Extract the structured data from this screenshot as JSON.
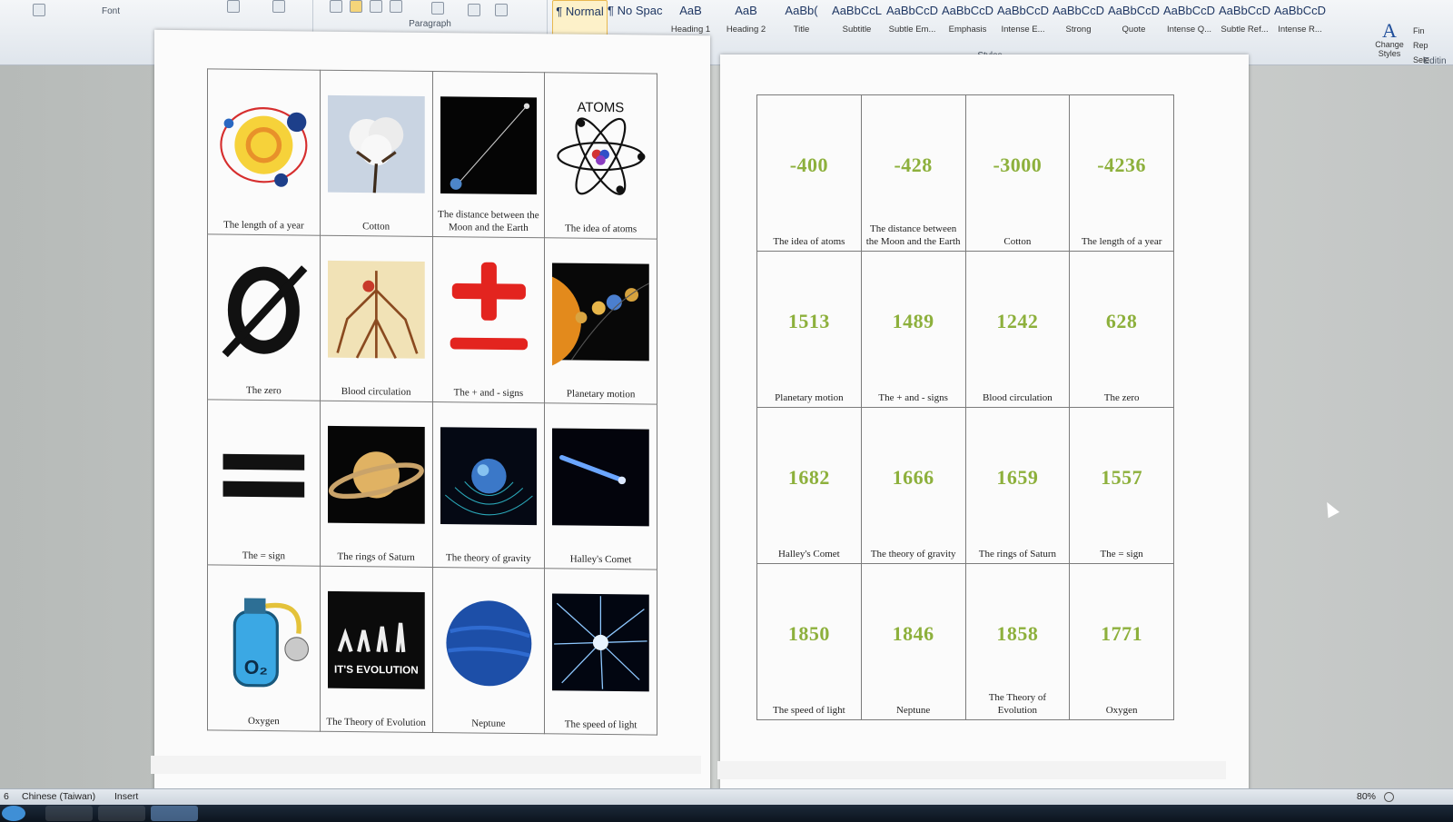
{
  "ribbon": {
    "groups": {
      "font": "Font",
      "paragraph": "Paragraph",
      "styles": "Styles",
      "editing": "Editin"
    },
    "styles": [
      {
        "preview": "¶ Normal",
        "name": "",
        "active": true
      },
      {
        "preview": "¶ No Spac...",
        "name": "",
        "active": false
      },
      {
        "preview": "AaB",
        "name": "Heading 1",
        "active": false
      },
      {
        "preview": "AaB",
        "name": "Heading 2",
        "active": false
      },
      {
        "preview": "AaBb(",
        "name": "Title",
        "active": false
      },
      {
        "preview": "AaBbCcL",
        "name": "Subtitle",
        "active": false
      },
      {
        "preview": "AaBbCcD",
        "name": "Subtle Em...",
        "active": false
      },
      {
        "preview": "AaBbCcD",
        "name": "Emphasis",
        "active": false
      },
      {
        "preview": "AaBbCcD",
        "name": "Intense E...",
        "active": false
      },
      {
        "preview": "AaBbCcD",
        "name": "Strong",
        "active": false
      },
      {
        "preview": "AaBbCcD",
        "name": "Quote",
        "active": false
      },
      {
        "preview": "AaBbCcD",
        "name": "Intense Q...",
        "active": false
      },
      {
        "preview": "AaBbCcD",
        "name": "Subtle Ref...",
        "active": false
      },
      {
        "preview": "AaBbCcD",
        "name": "Intense R...",
        "active": false
      }
    ],
    "change_styles": "Change Styles",
    "editing_items": [
      "Fin",
      "Rep",
      "Sele"
    ]
  },
  "left_table": [
    [
      {
        "caption": "The length of a year",
        "icon": "solar-orbit-icon"
      },
      {
        "caption": "Cotton",
        "icon": "cotton-icon"
      },
      {
        "caption": "The distance between the Moon and the Earth",
        "icon": "moon-earth-distance-icon"
      },
      {
        "caption": "The idea of atoms",
        "icon": "atom-icon",
        "label": "ATOMS"
      }
    ],
    [
      {
        "caption": "The zero",
        "icon": "zero-symbol-icon",
        "label": "Ø"
      },
      {
        "caption": "Blood circulation",
        "icon": "blood-circulation-icon"
      },
      {
        "caption": "The + and - signs",
        "icon": "plus-minus-icon"
      },
      {
        "caption": "Planetary motion",
        "icon": "planetary-motion-icon"
      }
    ],
    [
      {
        "caption": "The = sign",
        "icon": "equals-sign-icon"
      },
      {
        "caption": "The rings of Saturn",
        "icon": "saturn-icon"
      },
      {
        "caption": "The theory of gravity",
        "icon": "gravity-icon"
      },
      {
        "caption": "Halley's Comet",
        "icon": "comet-icon"
      }
    ],
    [
      {
        "caption": "Oxygen",
        "icon": "oxygen-tank-icon",
        "label": "O2"
      },
      {
        "caption": "The Theory of Evolution",
        "icon": "evolution-icon",
        "label": "IT'S EVOLUTION"
      },
      {
        "caption": "Neptune",
        "icon": "neptune-icon"
      },
      {
        "caption": "The speed of light",
        "icon": "light-burst-icon"
      }
    ]
  ],
  "right_table": [
    [
      {
        "year": "-400",
        "caption": "The idea of atoms"
      },
      {
        "year": "-428",
        "caption": "The distance between the Moon and the Earth"
      },
      {
        "year": "-3000",
        "caption": "Cotton"
      },
      {
        "year": "-4236",
        "caption": "The length of a year"
      }
    ],
    [
      {
        "year": "1513",
        "caption": "Planetary motion"
      },
      {
        "year": "1489",
        "caption": "The + and - signs"
      },
      {
        "year": "1242",
        "caption": "Blood circulation"
      },
      {
        "year": "628",
        "caption": "The zero"
      }
    ],
    [
      {
        "year": "1682",
        "caption": "Halley's Comet"
      },
      {
        "year": "1666",
        "caption": "The theory of gravity"
      },
      {
        "year": "1659",
        "caption": "The rings of Saturn"
      },
      {
        "year": "1557",
        "caption": "The = sign"
      }
    ],
    [
      {
        "year": "1850",
        "caption": "The speed of light"
      },
      {
        "year": "1846",
        "caption": "Neptune"
      },
      {
        "year": "1858",
        "caption": "The Theory of Evolution"
      },
      {
        "year": "1771",
        "caption": "Oxygen"
      }
    ]
  ],
  "statusbar": {
    "page": "6",
    "language": "Chinese (Taiwan)",
    "mode": "Insert",
    "zoom": "80%"
  },
  "colors": {
    "year_green": "#8db03c",
    "ribbon_bg": "#dfe5ec",
    "page_bg": "#fbfbfb"
  }
}
